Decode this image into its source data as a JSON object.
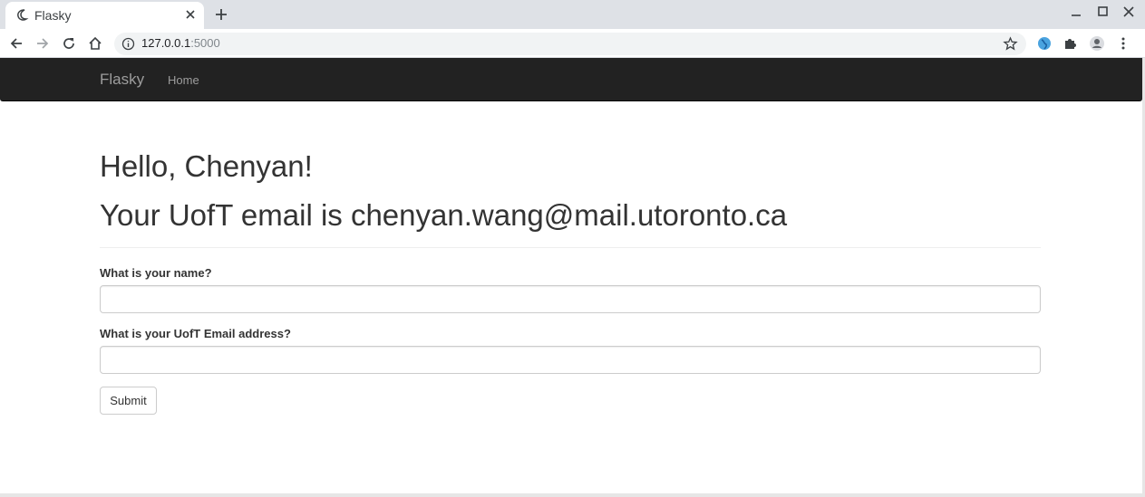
{
  "browser": {
    "tab_title": "Flasky",
    "url_host": "127.0.0.1",
    "url_port": ":5000"
  },
  "navbar": {
    "brand": "Flasky",
    "home": "Home"
  },
  "page": {
    "greeting": "Hello, Chenyan!",
    "email_line": "Your UofT email is chenyan.wang@mail.utoronto.ca"
  },
  "form": {
    "name_label": "What is your name?",
    "name_value": "",
    "email_label": "What is your UofT Email address?",
    "email_value": "",
    "submit_label": "Submit"
  }
}
